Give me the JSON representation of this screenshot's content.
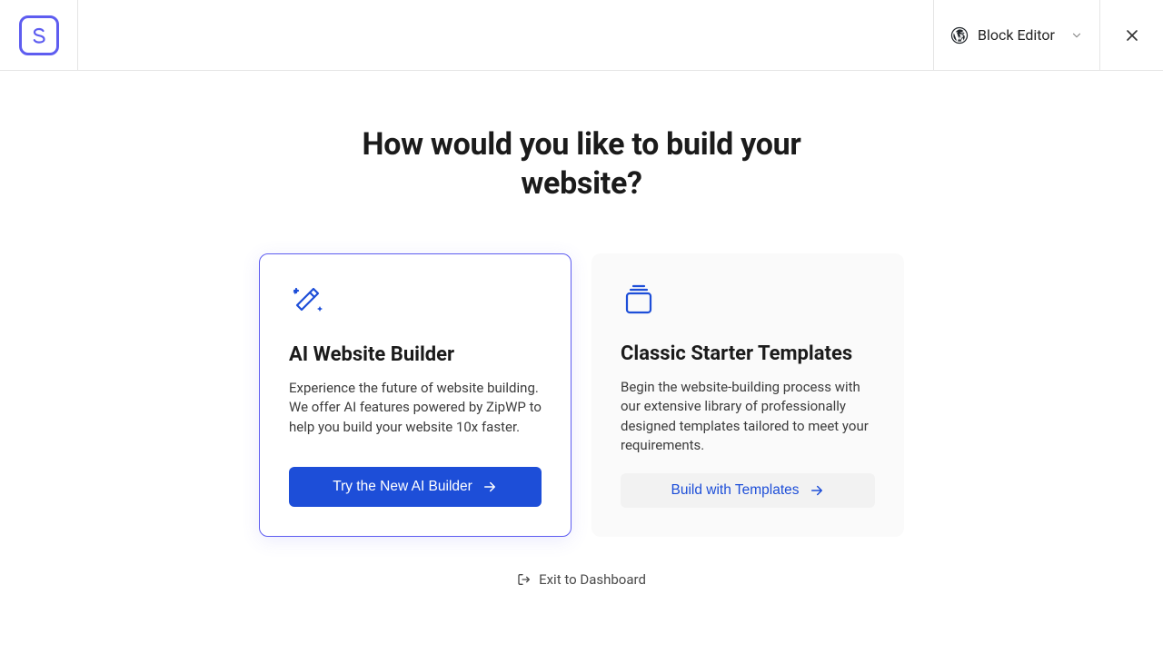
{
  "header": {
    "editor_label": "Block Editor"
  },
  "heading": "How would you like to build your website?",
  "cards": {
    "ai": {
      "title": "AI Website Builder",
      "desc": "Experience the future of website building. We offer AI features powered by ZipWP to help you build your website 10x faster.",
      "button": "Try the New AI Builder"
    },
    "classic": {
      "title": "Classic Starter Templates",
      "desc": "Begin the website-building process with our extensive library of professionally designed templates tailored to meet your requirements.",
      "button": "Build with Templates"
    }
  },
  "exit_label": "Exit to Dashboard"
}
